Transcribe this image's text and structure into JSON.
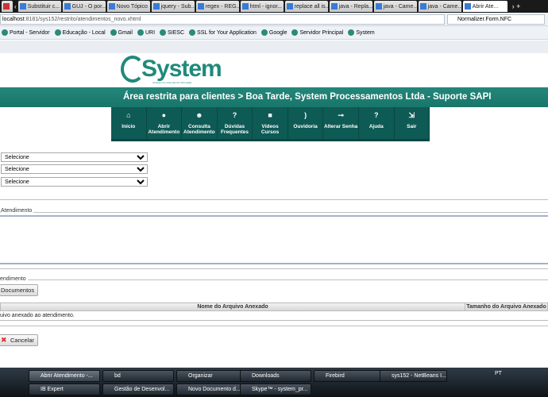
{
  "browser": {
    "tabs": [
      "Substituir c...",
      "GUJ - O por...",
      "Novo Tópico",
      "jquery - Sub...",
      "regex - REG...",
      "html - ignor...",
      "replace all is...",
      "java - Repla...",
      "java - Came...",
      "java - Came...",
      "Abrir Ate..."
    ],
    "url_host": "localhost",
    "url_rest": ":8181/sys152/restrito/atendimentos_novo.xhtml",
    "search": "Normalizer.Form.NFC",
    "bookmarks": [
      "Portal - Servidor",
      "Educação - Local",
      "Gmail",
      "URI",
      "SIESC",
      "SSL for Your Application",
      "Google",
      "Servidor Principal",
      "System"
    ]
  },
  "logo": {
    "name": "System",
    "tagline": "soluções em sistemas de informação"
  },
  "banner": "Área restrita para clientes > Boa Tarde, System Processamentos Ltda - Suporte SAPI",
  "menu": [
    {
      "icon": "home-icon",
      "glyph": "⌂",
      "label": "Início"
    },
    {
      "icon": "chat-icon",
      "glyph": "●",
      "label": "Abrir Atendimento"
    },
    {
      "icon": "users-icon",
      "glyph": "☻",
      "label": "Consulta Atendimento"
    },
    {
      "icon": "question-icon",
      "glyph": "?",
      "label": "Dúvidas Frequentes"
    },
    {
      "icon": "video-icon",
      "glyph": "■",
      "label": "Vídeos Cursos"
    },
    {
      "icon": "sound-icon",
      "glyph": ")",
      "label": "Ouvidoria"
    },
    {
      "icon": "key-icon",
      "glyph": "⊸",
      "label": "Alterar Senha"
    },
    {
      "icon": "help-icon",
      "glyph": "?",
      "label": "Ajuda"
    },
    {
      "icon": "exit-icon",
      "glyph": "⇲",
      "label": "Sair"
    }
  ],
  "form": {
    "selects": [
      "Selecione",
      "Selecione",
      "Selecione"
    ],
    "legend1": "Atendimento",
    "legend2": "endimento",
    "documents_button": "Documentos",
    "table": {
      "headers": [
        "Nome do Arquivo Anexado",
        "Tamanho do Arquivo Anexado"
      ],
      "empty": "uivo anexado ao atendimento."
    },
    "cancel_button": "Cancelar"
  },
  "taskbar": {
    "row1": [
      "Abrir Atendimento -...",
      "bd",
      "Organizar",
      "Downloads",
      "Firebird",
      "sys152 - NetBeans I..."
    ],
    "row2": [
      "IB Expert",
      "Gestão de Desenvol...",
      "Novo Documento d...",
      "Skype™ - system_pr..."
    ],
    "lang": "PT"
  }
}
